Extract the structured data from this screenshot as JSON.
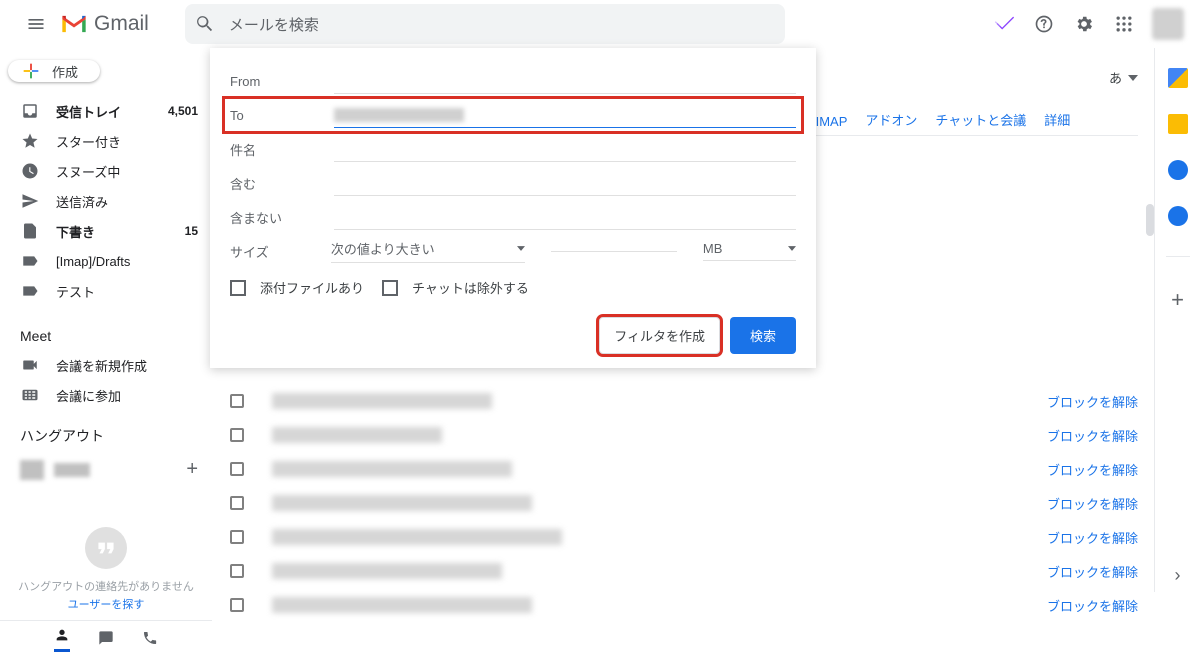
{
  "header": {
    "logo_text": "Gmail",
    "search_placeholder": "メールを検索"
  },
  "compose_label": "作成",
  "nav": {
    "inbox": {
      "label": "受信トレイ",
      "count": "4,501"
    },
    "starred": {
      "label": "スター付き"
    },
    "snoozed": {
      "label": "スヌーズ中"
    },
    "sent": {
      "label": "送信済み"
    },
    "drafts": {
      "label": "下書き",
      "count": "15"
    },
    "imap_drafts": {
      "label": "[Imap]/Drafts"
    },
    "test": {
      "label": "テスト"
    }
  },
  "meet": {
    "header": "Meet",
    "new": "会議を新規作成",
    "join": "会議に参加"
  },
  "hangout": {
    "header": "ハングアウト",
    "empty_msg": "ハングアウトの連絡先がありません",
    "find_user": "ユーザーを探す"
  },
  "lang_selector": "あ",
  "settings_tabs": {
    "imap": "/IMAP",
    "addons": "アドオン",
    "chat": "チャットと会議",
    "detail": "詳細"
  },
  "filter": {
    "from": "From",
    "to": "To",
    "subject": "件名",
    "has_words": "含む",
    "no_words": "含まない",
    "size": "サイズ",
    "size_op": "次の値より大きい",
    "size_unit": "MB",
    "has_attachment": "添付ファイルあり",
    "exclude_chat": "チャットは除外する",
    "create_filter": "フィルタを作成",
    "search": "検索"
  },
  "unblock_link": "ブロックを解除"
}
